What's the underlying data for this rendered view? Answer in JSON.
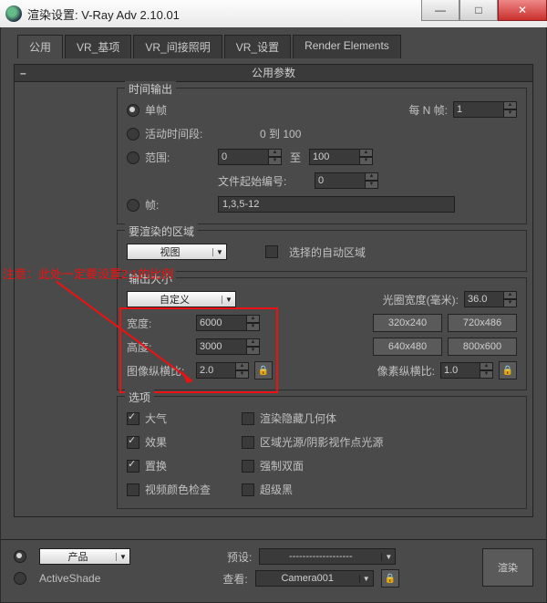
{
  "titlebar": {
    "title": "渲染设置: V-Ray Adv 2.10.01"
  },
  "tabs": [
    "公用",
    "VR_基项",
    "VR_间接照明",
    "VR_设置",
    "Render Elements"
  ],
  "rollout_title": "公用参数",
  "annotation": "注意：此处一定要设置2:1的比例",
  "timeOutput": {
    "title": "时间输出",
    "single": "单帧",
    "nth_label": "每 N 帧:",
    "nth": "1",
    "active": "活动时间段:",
    "active_range": "0 到 100",
    "range": "范围:",
    "from": "0",
    "to_lbl": "至",
    "to": "100",
    "filestart": "文件起始编号:",
    "filestart_v": "0",
    "frames": "帧:",
    "frames_v": "1,3,5-12"
  },
  "area": {
    "title": "要渲染的区域",
    "view": "视图",
    "auto": "选择的自动区域"
  },
  "outsize": {
    "title": "输出大小",
    "custom": "自定义",
    "aperture_lbl": "光圈宽度(毫米):",
    "aperture": "36.0",
    "width_lbl": "宽度:",
    "width": "6000",
    "height_lbl": "高度:",
    "height": "3000",
    "aspect_lbl": "图像纵横比:",
    "aspect": "2.0",
    "pixel_lbl": "像素纵横比:",
    "pixel": "1.0",
    "presets": [
      "320x240",
      "720x486",
      "640x480",
      "800x600"
    ]
  },
  "options": {
    "title": "选项",
    "atmo": "大气",
    "hidden": "渲染隐藏几何体",
    "effects": "效果",
    "arealights": "区域光源/阴影视作点光源",
    "disp": "置换",
    "force2": "强制双面",
    "colorcheck": "视频颜色检查",
    "superblack": "超级黑"
  },
  "bottom": {
    "product": "产品",
    "preset_lbl": "预设:",
    "preset_v": "-------------------",
    "activeshade": "ActiveShade",
    "view_lbl": "查看:",
    "view_v": "Camera001",
    "render": "渲染"
  }
}
